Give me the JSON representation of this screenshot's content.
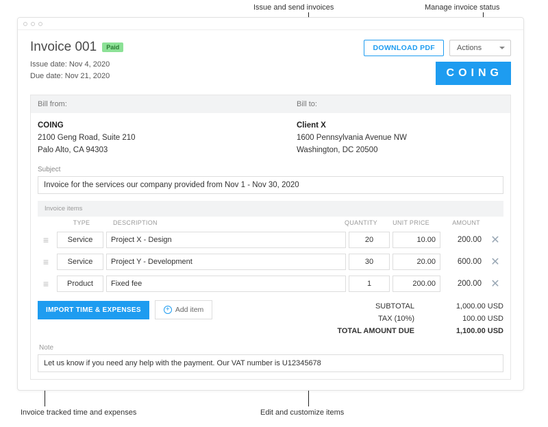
{
  "annotations": {
    "issue_send": "Issue and send invoices",
    "manage_status": "Manage invoice status",
    "tracked": "Invoice tracked time and expenses",
    "edit_items": "Edit and customize items"
  },
  "header": {
    "title": "Invoice 001",
    "badge": "Paid",
    "issue_date_label": "Issue date: Nov 4, 2020",
    "due_date_label": "Due date: Nov 21, 2020",
    "download_label": "DOWNLOAD PDF",
    "actions_label": "Actions",
    "logo": "COING"
  },
  "bill": {
    "from_label": "Bill from:",
    "to_label": "Bill to:",
    "from": {
      "name": "COING",
      "line1": "2100 Geng Road, Suite 210",
      "line2": "Palo Alto, CA 94303"
    },
    "to": {
      "name": "Client X",
      "line1": "1600 Pennsylvania Avenue NW",
      "line2": "Washington, DC 20500"
    }
  },
  "subject": {
    "label": "Subject",
    "value": "Invoice for the services our company provided from Nov 1 - Nov 30, 2020"
  },
  "items_section": {
    "header": "Invoice items",
    "cols": {
      "type": "TYPE",
      "description": "DESCRIPTION",
      "quantity": "QUANTITY",
      "unit_price": "UNIT PRICE",
      "amount": "AMOUNT"
    },
    "items": [
      {
        "type": "Service",
        "description": "Project X - Design",
        "quantity": "20",
        "unit_price": "10.00",
        "amount": "200.00"
      },
      {
        "type": "Service",
        "description": "Project Y - Development",
        "quantity": "30",
        "unit_price": "20.00",
        "amount": "600.00"
      },
      {
        "type": "Product",
        "description": "Fixed fee",
        "quantity": "1",
        "unit_price": "200.00",
        "amount": "200.00"
      }
    ]
  },
  "actions": {
    "import": "IMPORT TIME & EXPENSES",
    "add_item": "Add item"
  },
  "totals": {
    "subtotal_label": "SUBTOTAL",
    "subtotal_value": "1,000.00 USD",
    "tax_label": "TAX  (10%)",
    "tax_value": "100.00 USD",
    "due_label": "TOTAL AMOUNT DUE",
    "due_value": "1,100.00 USD"
  },
  "note": {
    "label": "Note",
    "value": "Let us know if you need any help with the payment. Our VAT number is U12345678"
  }
}
